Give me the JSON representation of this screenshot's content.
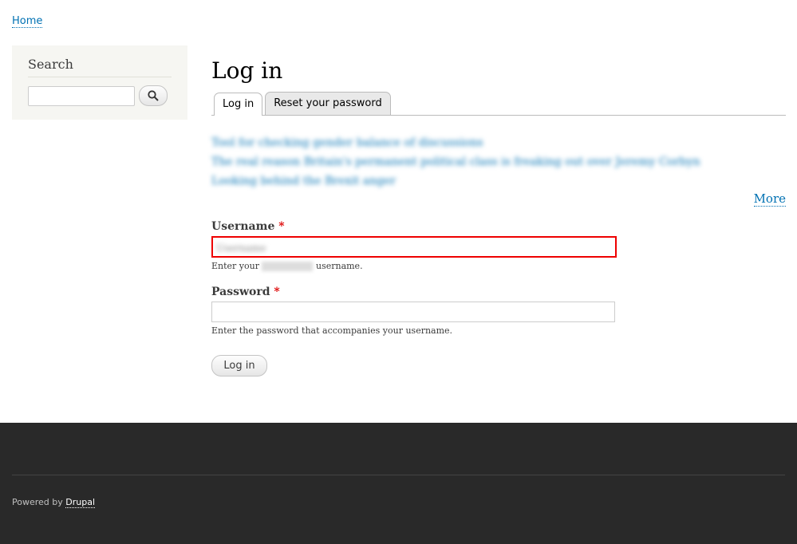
{
  "breadcrumb": {
    "home": "Home"
  },
  "sidebar": {
    "title": "Search",
    "search_input": {
      "value": "",
      "placeholder": ""
    },
    "search_icon": "magnifier-icon"
  },
  "main": {
    "title": "Log in",
    "tabs": [
      {
        "label": "Log in",
        "active": true
      },
      {
        "label": "Reset your password",
        "active": false
      }
    ],
    "news_items": [
      {
        "label": "Tool for checking gender balance of discussions"
      },
      {
        "label": "The real reason Britain's permanent political class is freaking out over Jeremy Corbyn"
      },
      {
        "label": "Looking behind the Brexit anger"
      }
    ],
    "more_link": "More",
    "username": {
      "label": "Username",
      "required_mark": "*",
      "value": "Username",
      "desc_prefix": "Enter your",
      "desc_suffix": "username."
    },
    "password": {
      "label": "Password",
      "required_mark": "*",
      "value": "",
      "desc": "Enter the password that accompanies your username."
    },
    "submit_label": "Log in"
  },
  "footer": {
    "powered_by": "Powered by",
    "drupal_link": "Drupal"
  },
  "colors": {
    "link": "#0071b3",
    "error_border": "#ee0000",
    "footer_bg": "#292929",
    "sidebar_bg": "#f6f6f2"
  }
}
